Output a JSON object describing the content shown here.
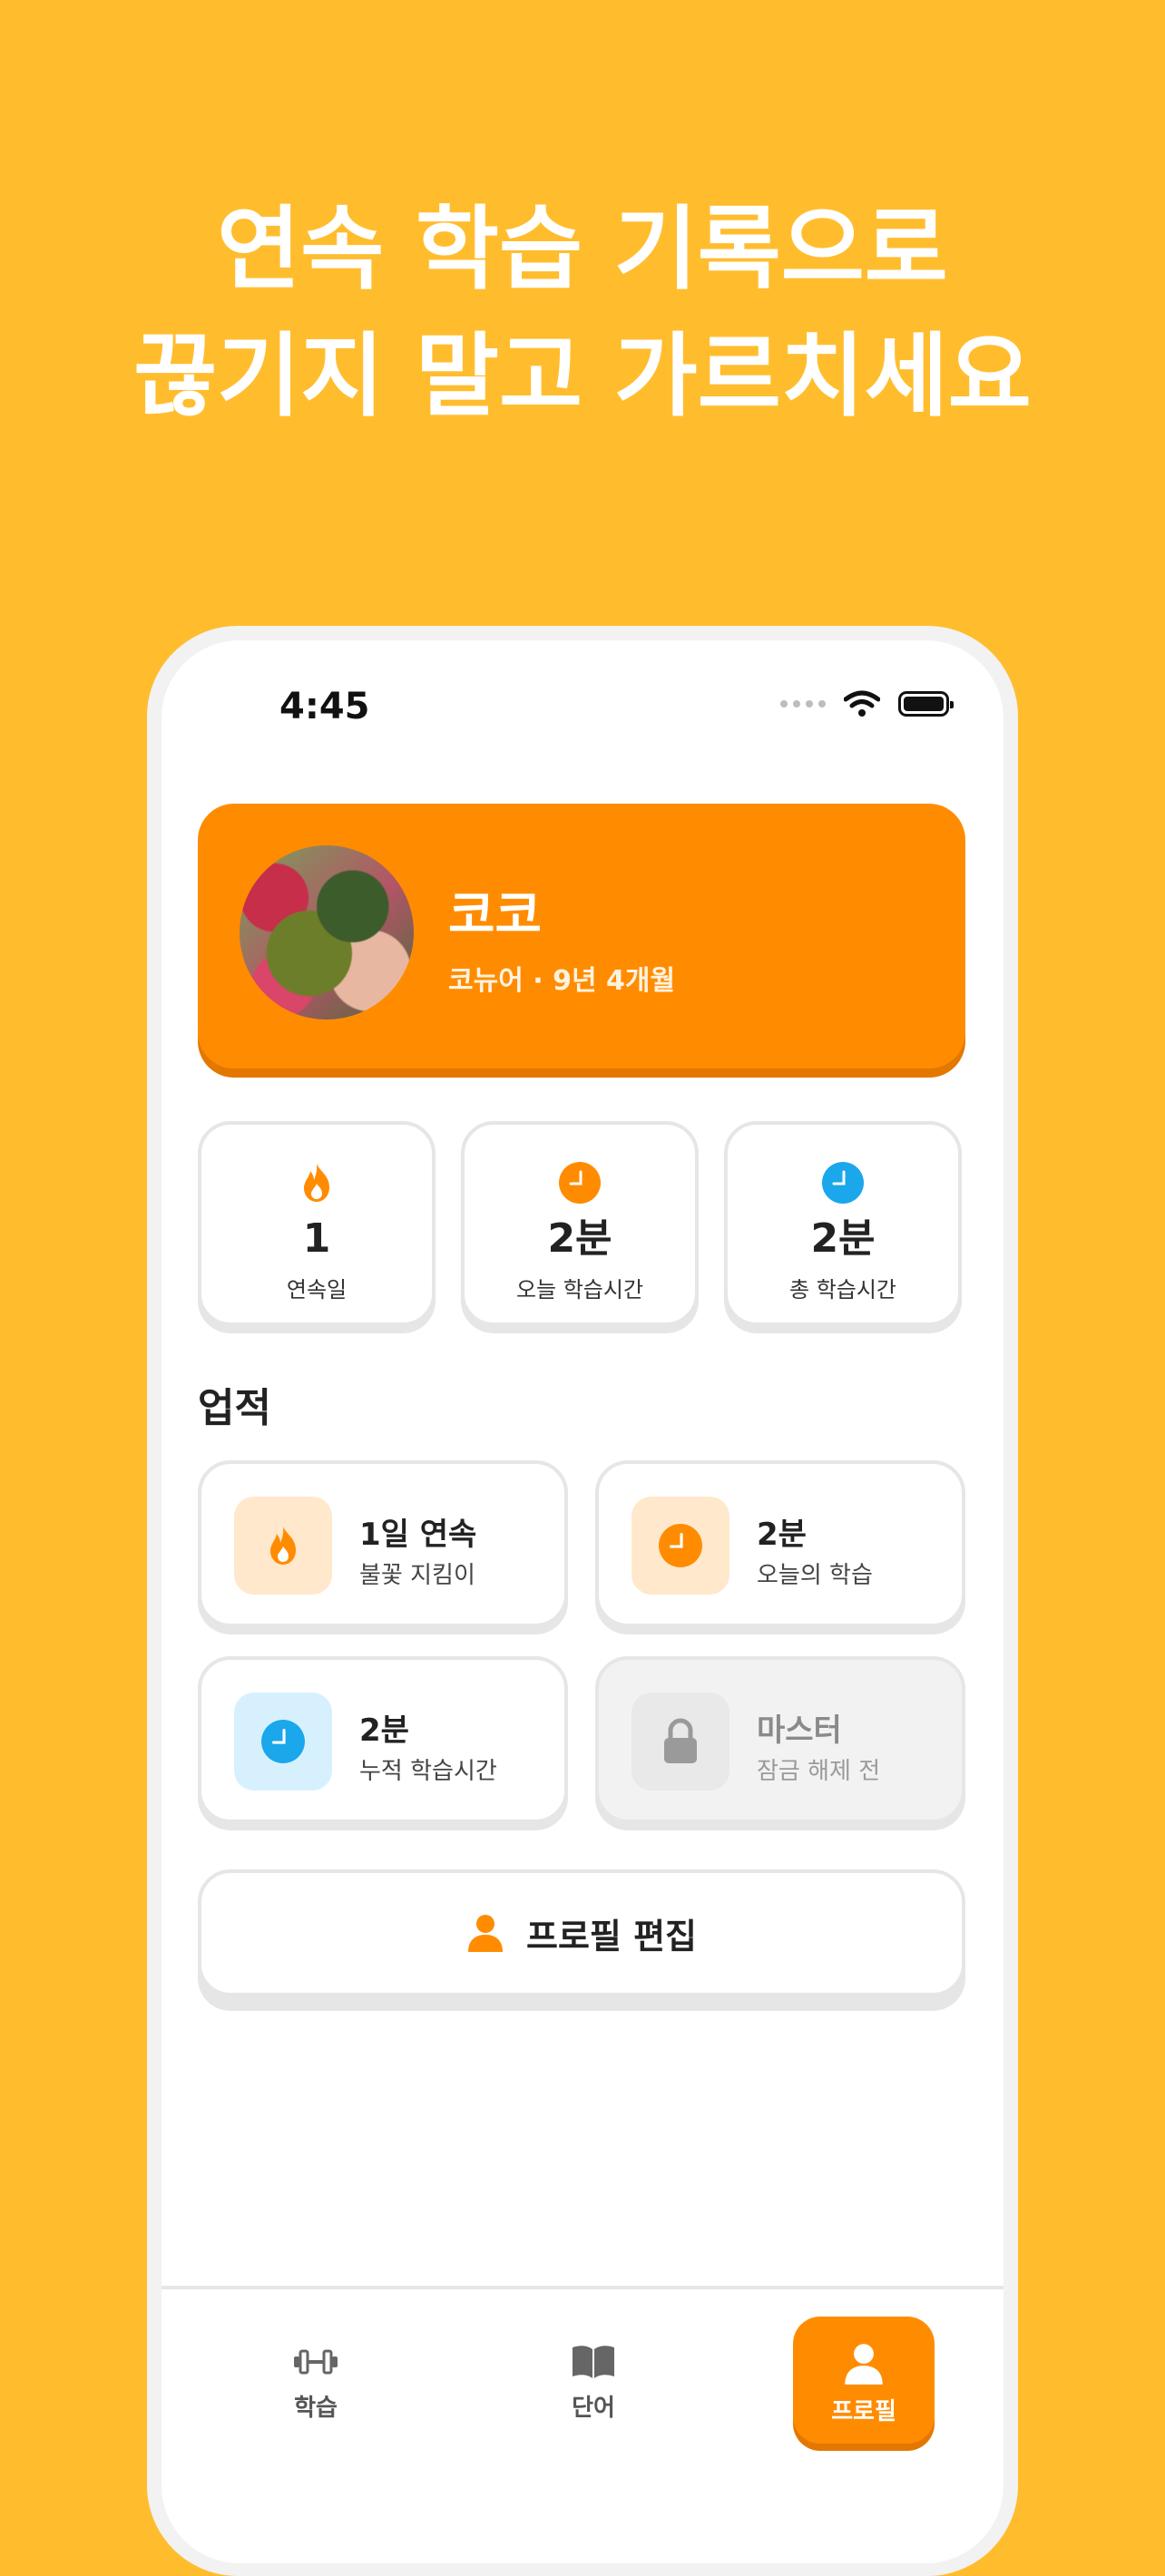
{
  "headline": {
    "line1": "연속 학습 기록으로",
    "line2": "끊기지 말고 가르치세요"
  },
  "status_bar": {
    "time": "4:45"
  },
  "profile": {
    "name": "코코",
    "subtitle": "코뉴어 · 9년 4개월"
  },
  "stats": [
    {
      "icon": "flame-icon",
      "value": "1",
      "label": "연속일"
    },
    {
      "icon": "clock-orange-icon",
      "value": "2분",
      "label": "오늘 학습시간"
    },
    {
      "icon": "clock-blue-icon",
      "value": "2분",
      "label": "총 학습시간"
    }
  ],
  "achievements": {
    "title": "업적",
    "items": [
      {
        "icon": "flame-icon",
        "title": "1일 연속",
        "subtitle": "불꽃 지킴이",
        "locked": false
      },
      {
        "icon": "clock-orange-icon",
        "title": "2분",
        "subtitle": "오늘의 학습",
        "locked": false
      },
      {
        "icon": "clock-blue-icon",
        "title": "2분",
        "subtitle": "누적 학습시간",
        "locked": false
      },
      {
        "icon": "lock-icon",
        "title": "마스터",
        "subtitle": "잠금 해제 전",
        "locked": true
      }
    ]
  },
  "edit_profile_button": "프로필 편집",
  "tabs": [
    {
      "icon": "dumbbell-icon",
      "label": "학습",
      "active": false
    },
    {
      "icon": "book-icon",
      "label": "단어",
      "active": false
    },
    {
      "icon": "person-icon",
      "label": "프로필",
      "active": true
    }
  ],
  "colors": {
    "background": "#FFBD2E",
    "accent": "#FF8C00",
    "blue": "#1AA7EC"
  }
}
